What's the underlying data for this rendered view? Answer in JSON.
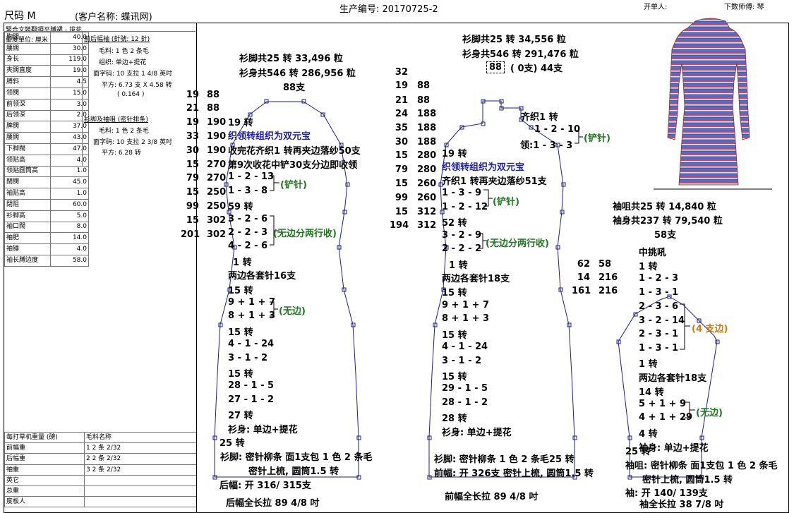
{
  "header": {
    "size": "尺码  M",
    "customer": "(客户名称: 蝶讯网)",
    "production_no": "生产编号: 20170725-2",
    "order_by": "开单人:",
    "master": "下数师傅: 琴"
  },
  "left_panel": {
    "title": "緊合文裝翻領平膊裙 - 拔花",
    "unit": "量度單位: 厘米",
    "specs": [
      {
        "k": "胸闊",
        "v": "40.0"
      },
      {
        "k": "腰闊",
        "v": "30.0"
      },
      {
        "k": "身长",
        "v": "119.0"
      },
      {
        "k": "夾闊直度",
        "v": "19.0"
      },
      {
        "k": "膊斜",
        "v": "4.5"
      },
      {
        "k": "领闊",
        "v": "15.0"
      },
      {
        "k": "前领深",
        "v": "3.0"
      },
      {
        "k": "后领深",
        "v": "2.0"
      },
      {
        "k": "脾闊",
        "v": "37.0"
      },
      {
        "k": "腰闊",
        "v": "43.0"
      },
      {
        "k": "下脚闊",
        "v": "47.0"
      },
      {
        "k": "领贴高",
        "v": "4.0"
      },
      {
        "k": "领贴圆筒高",
        "v": "1.0"
      },
      {
        "k": "閉闊",
        "v": "45.0"
      },
      {
        "k": "袖贴高",
        "v": "1.0"
      },
      {
        "k": "閉阻",
        "v": "60.0"
      },
      {
        "k": "衫脚高",
        "v": "5.0"
      },
      {
        "k": "袖口闊",
        "v": "8.0"
      },
      {
        "k": "袖肥",
        "v": "14.0"
      },
      {
        "k": "袖锤",
        "v": "4.0"
      },
      {
        "k": "袖长膊边度",
        "v": "58.0"
      }
    ],
    "body_info": {
      "title": "前后幅袖 (針號: 12 針)",
      "yarn": "毛料: 1 色 2 条毛",
      "structure": "组织: 单边+提花",
      "gauge": "面字码: 10 支拉 1 4/8 英吋",
      "density": "平方: 6.73 支 X  4.58 转",
      "ratio": "( 0.164 )"
    },
    "rib_info": {
      "title": "衫脚及袖咀 (密针排条)",
      "yarn": "毛料: 1 色 2 条毛",
      "gauge": "面字码: 10 支拉 2 3/8 英吋",
      "density": "平方: 6.28 转"
    },
    "yarn_table": {
      "h1": "每打草机重量 (磅)",
      "h2": "毛料名称",
      "rows": [
        {
          "k": "前幅重",
          "v": "1  2 条 2/32"
        },
        {
          "k": "后幅重",
          "v": "2  2 条 2/32"
        },
        {
          "k": "袖重",
          "v": "3  2 条 2/32"
        },
        {
          "k": "英它",
          "v": ""
        },
        {
          "k": "总重",
          "v": ""
        },
        {
          "k": "度板人",
          "v": ""
        }
      ]
    }
  },
  "back": {
    "hem_total": "衫脚共25 转 33,496 粒",
    "body_total": "衫身共546 转 286,956 粒",
    "needles": "88支",
    "numbers": [
      {
        "a": "19",
        "b": "88"
      },
      {
        "a": "21",
        "b": "88"
      },
      {
        "a": "19",
        "b": "190"
      },
      {
        "a": "33",
        "b": "190"
      },
      {
        "a": "30",
        "b": "190"
      },
      {
        "a": "15",
        "b": "270"
      },
      {
        "a": "79",
        "b": "270"
      },
      {
        "a": "15",
        "b": "250"
      },
      {
        "a": "99",
        "b": "250"
      },
      {
        "a": "15",
        "b": "302"
      },
      {
        "a": "201",
        "b": "302"
      }
    ],
    "neck_l1": "19 转",
    "neck_blue": "织领转组织为双元宝",
    "neck_l2": "收完花齐织1 转再夹边落纱50支",
    "neck_l3": "第9次收花中铲30支分边即收领",
    "s1": "1 - 2 - 13",
    "s2": "1 - 3 - 8",
    "ann_shovel": "(铲针)",
    "l59": "59 转",
    "s3": "3 - 2 - 6",
    "s4": "2 - 2 - 3",
    "s5": "4 - 2 - 6",
    "ann_nosplit": "(无边分两行收)",
    "l1": "1 转",
    "cover": "两边各套针16支",
    "l15a": "15 转",
    "i1": "9 + 1 + 7",
    "i2": "8 + 1 + 3",
    "ann_noedge": "(无边)",
    "l15b": "15 转",
    "r1": "4 - 1 - 24",
    "r2": "3 - 1 - 2",
    "l15c": "15 转",
    "r3": "28 - 1 - 5",
    "r4": "27 - 1 - 2",
    "l27": "27 转",
    "body_struct": "衫身: 单边+提花",
    "l25": "25 转",
    "hem_desc": "衫脚: 密针柳条  面1支包 1 色 2 条毛",
    "hem_desc2": "密针上梳, 圆筒1.5 转",
    "cast": "后幅: 开 316/ 315支",
    "full_len": "后幅全长拉 89 4/8 吋"
  },
  "front": {
    "hem_total": "衫脚共25 转 34,556 粒",
    "body_total": "衫身共546 转 291,476 粒",
    "neck_boxed": "88",
    "neck_rest": "( 0支) 44支",
    "numbers": [
      {
        "a": "32",
        "b": ""
      },
      {
        "a": "19",
        "b": "88"
      },
      {
        "a": "21",
        "b": "88"
      },
      {
        "a": "24",
        "b": "188"
      },
      {
        "a": "35",
        "b": "188"
      },
      {
        "a": "30",
        "b": "188"
      },
      {
        "a": "15",
        "b": "280"
      },
      {
        "a": "79",
        "b": "280"
      },
      {
        "a": "15",
        "b": "260"
      },
      {
        "a": "99",
        "b": "260"
      },
      {
        "a": "15",
        "b": "312"
      },
      {
        "a": "194",
        "b": "312"
      }
    ],
    "qizhi": "齐织1 转",
    "n1": "1 - 2 - 10",
    "n2": "领:1 - 3 - 3",
    "ann_shovel": "(铲针)",
    "l19": "19 转",
    "neck_blue": "织领转组织为双元宝",
    "neck_l2": "齐织1 转再夹边落纱51支",
    "s1": "1 - 3 - 9",
    "s2": "1 - 2 - 12",
    "ann_shovel2": "(铲针)",
    "l52": "52 转",
    "s3": "3 - 2 - 9",
    "s4": "2 - 2 - 2",
    "ann_nosplit": "(无边分两行收)",
    "l1": "1 转",
    "cover": "两边各套针18支",
    "l15a": "15 转",
    "i1": "9 + 1 + 7",
    "i2": "8 + 1 + 3",
    "l15b": "15 转",
    "r1": "4 - 1 - 24",
    "r2": "3 - 1 - 2",
    "l15c": "15 转",
    "r3": "29 - 1 - 5",
    "r4": "28 - 1 - 2",
    "l28": "28 转",
    "body_struct": "衫身: 单边+提花",
    "hem_desc": "衫脚: 密针柳条  1 色 2 条毛25 转",
    "cast": "前幅: 开 326支 密针上梳, 圆筒1.5 转",
    "full_len": "前幅全长拉 89 4/8 吋"
  },
  "sleeve_numbers": [
    {
      "a": "62",
      "b": "58"
    },
    {
      "a": "14",
      "b": "216"
    },
    {
      "a": "161",
      "b": "216"
    }
  ],
  "sleeve": {
    "cuff_total": "袖咀共25 转 14,840 粒",
    "body_total": "袖身共237 转 79,540 粒",
    "needles": "58支",
    "center": "中挑吼",
    "l1": "1 转",
    "c1": "1 - 2 - 3",
    "c2": "1 - 3 - 1",
    "c3": "2 - 3 - 6",
    "c4": "3 - 2 - 14",
    "c5": "2 - 3 - 1",
    "c6": "1 - 3 - 1",
    "ann_edge4": "(4 支边)",
    "l1b": "1 转",
    "cover": "两边各套针18支",
    "l14": "14 转",
    "i1": "5 + 1 + 9",
    "i2": "4 + 1 + 29",
    "ann_noedge": "(无边)",
    "l4": "4 转",
    "l25": "25 转",
    "body_struct": "袖身: 单边+提花",
    "cuff_desc": "袖咀: 密针柳条  面1支包 1 色 2 条毛",
    "cuff_desc2": "密针上梳, 圆筒1.5 转",
    "cast": "袖: 开 140/ 139支",
    "full_len": "袖全长拉 38 7/8 吋"
  },
  "colors": {
    "blue": "#1f1fb0",
    "green": "#1d7a1d",
    "orange": "#d07a10",
    "outline": "#1e1e8c"
  }
}
